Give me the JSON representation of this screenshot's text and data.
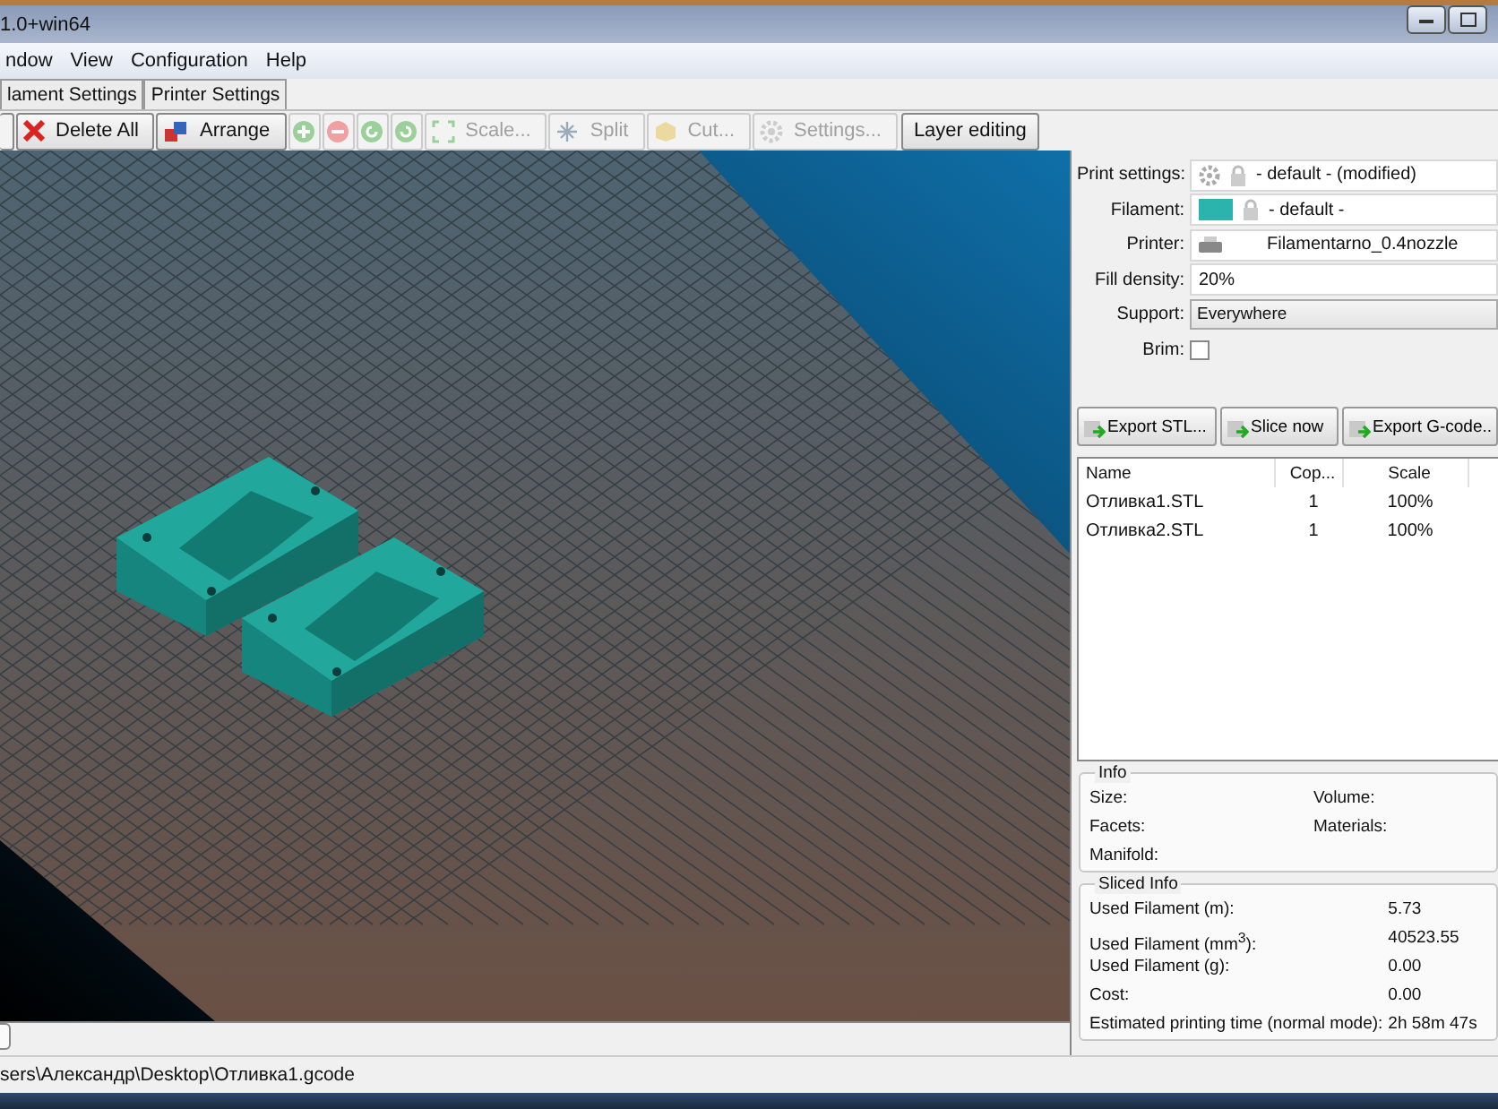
{
  "window": {
    "title": "1.0+win64"
  },
  "menu": [
    "ndow",
    "View",
    "Configuration",
    "Help"
  ],
  "tabs": [
    {
      "label": "lament Settings",
      "selected": false
    },
    {
      "label": "Printer Settings",
      "selected": false
    }
  ],
  "toolbar": [
    {
      "kind": "text",
      "label": "Delete All",
      "disabled": false
    },
    {
      "kind": "text",
      "label": "Arrange",
      "disabled": false
    },
    {
      "kind": "icon",
      "disabled": true
    },
    {
      "kind": "icon",
      "disabled": true
    },
    {
      "kind": "icon",
      "disabled": true
    },
    {
      "kind": "icon",
      "disabled": true
    },
    {
      "kind": "text",
      "label": "Scale...",
      "disabled": true
    },
    {
      "kind": "text",
      "label": "Split",
      "disabled": true
    },
    {
      "kind": "text",
      "label": "Cut...",
      "disabled": true
    },
    {
      "kind": "text",
      "label": "Settings...",
      "disabled": true
    },
    {
      "kind": "text",
      "label": "Layer editing",
      "disabled": false
    }
  ],
  "settings": [
    {
      "kind": "preset",
      "label": "Print settings:",
      "value": "- default - (modified)"
    },
    {
      "kind": "swatch",
      "label": "Filament:",
      "color": "#2bb3ad",
      "value": "- default -"
    },
    {
      "kind": "printer",
      "label": "Printer:",
      "value": "Filamentarno_0.4nozzle"
    },
    {
      "kind": "text",
      "label": "Fill density:",
      "value": "20%"
    },
    {
      "kind": "select",
      "label": "Support:",
      "value": "Everywhere"
    },
    {
      "kind": "checkbox",
      "label": "Brim:",
      "checked": false
    }
  ],
  "actions": [
    "Export STL...",
    "Slice now",
    "Export G-code.."
  ],
  "objects": {
    "columns": [
      "Name",
      "Cop...",
      "Scale"
    ],
    "rows": [
      [
        "Отливка1.STL",
        "1",
        "100%"
      ],
      [
        "Отливка2.STL",
        "1",
        "100%"
      ]
    ]
  },
  "info": {
    "title": "Info",
    "fields": [
      [
        "Size:",
        "Volume:"
      ],
      [
        "Facets:",
        "Materials:"
      ],
      [
        "Manifold:"
      ]
    ]
  },
  "sliced_info": {
    "title": "Sliced Info",
    "rows": [
      [
        "Used Filament (m):",
        "5.73"
      ],
      [
        "Used Filament (mm$^{3}$):",
        "40523.55"
      ],
      [
        "Used Filament (g):",
        "0.00"
      ],
      [
        "Cost:",
        "0.00"
      ],
      [
        "Estimated printing time (normal mode):",
        "2h 58m 47s"
      ]
    ]
  },
  "status_bar": "sers\\Александр\\Desktop\\Отливка1.gcode"
}
